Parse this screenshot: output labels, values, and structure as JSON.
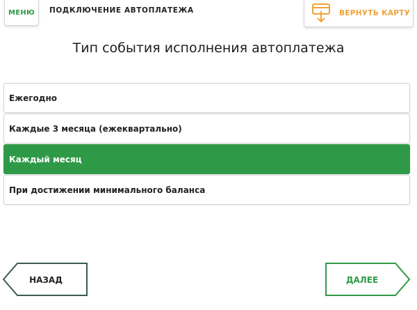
{
  "header": {
    "menu_label": "МЕНЮ",
    "title": "ПОДКЛЮЧЕНИЕ АВТОПЛАТЕЖА",
    "return_card_label": "ВЕРНУТЬ КАРТУ",
    "return_card_icon": "card-eject-icon"
  },
  "main": {
    "title": "Тип события исполнения автоплатежа",
    "options": [
      {
        "label": "Ежегодно",
        "selected": false
      },
      {
        "label": "Каждые 3 месяца (ежеквартально)",
        "selected": false
      },
      {
        "label": "Каждый месяц",
        "selected": true
      },
      {
        "label": "При достижении минимального баланса",
        "selected": false
      }
    ]
  },
  "nav": {
    "back_label": "НАЗАД",
    "next_label": "ДАЛЕЕ"
  },
  "colors": {
    "accent_green": "#2e9a47",
    "accent_orange": "#f0a33a",
    "back_border": "#3d5a57"
  }
}
